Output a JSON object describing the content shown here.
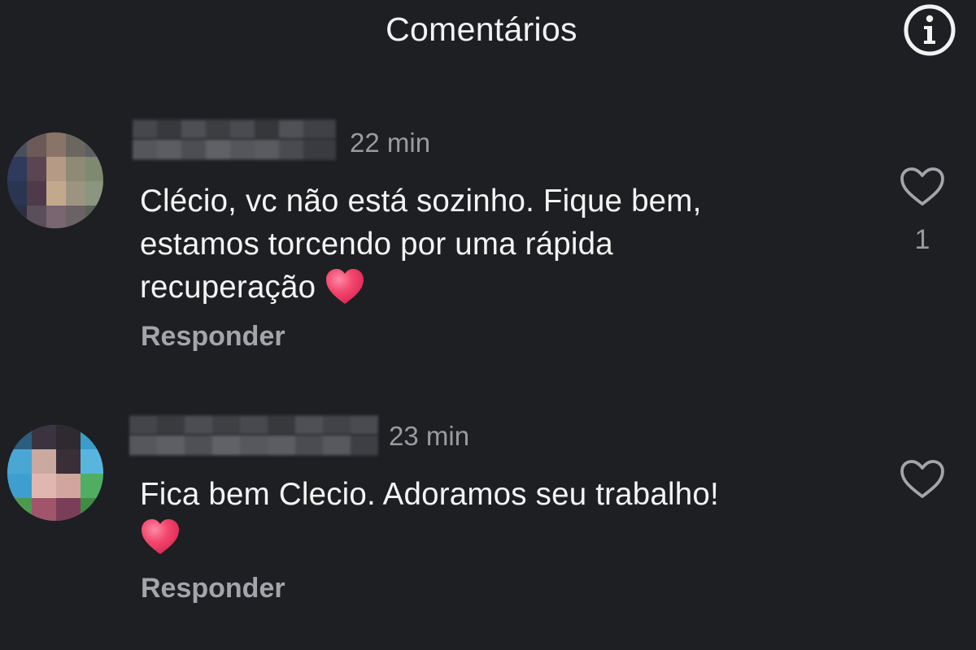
{
  "header": {
    "title": "Comentários",
    "info_icon": "info-icon"
  },
  "colors": {
    "background": "#1e1f22",
    "text": "#f4f4f4",
    "muted": "#9a9ba0",
    "heart": "#e8365d"
  },
  "comments": [
    {
      "username_blurred": true,
      "time": "22 min",
      "text": "Clécio, vc não está sozinho. Fique bem,\nestamos torcendo por uma rápida\nrecuperação",
      "emoji": "red-heart-emoji",
      "reply_label": "Responder",
      "like_icon": "heart-outline-icon",
      "like_count": "1"
    },
    {
      "username_blurred": true,
      "time": "23 min",
      "text": "Fica bem Clecio. Adoramos seu trabalho!\n",
      "emoji": "red-heart-emoji",
      "reply_label": "Responder",
      "like_icon": "heart-outline-icon",
      "like_count": ""
    }
  ]
}
